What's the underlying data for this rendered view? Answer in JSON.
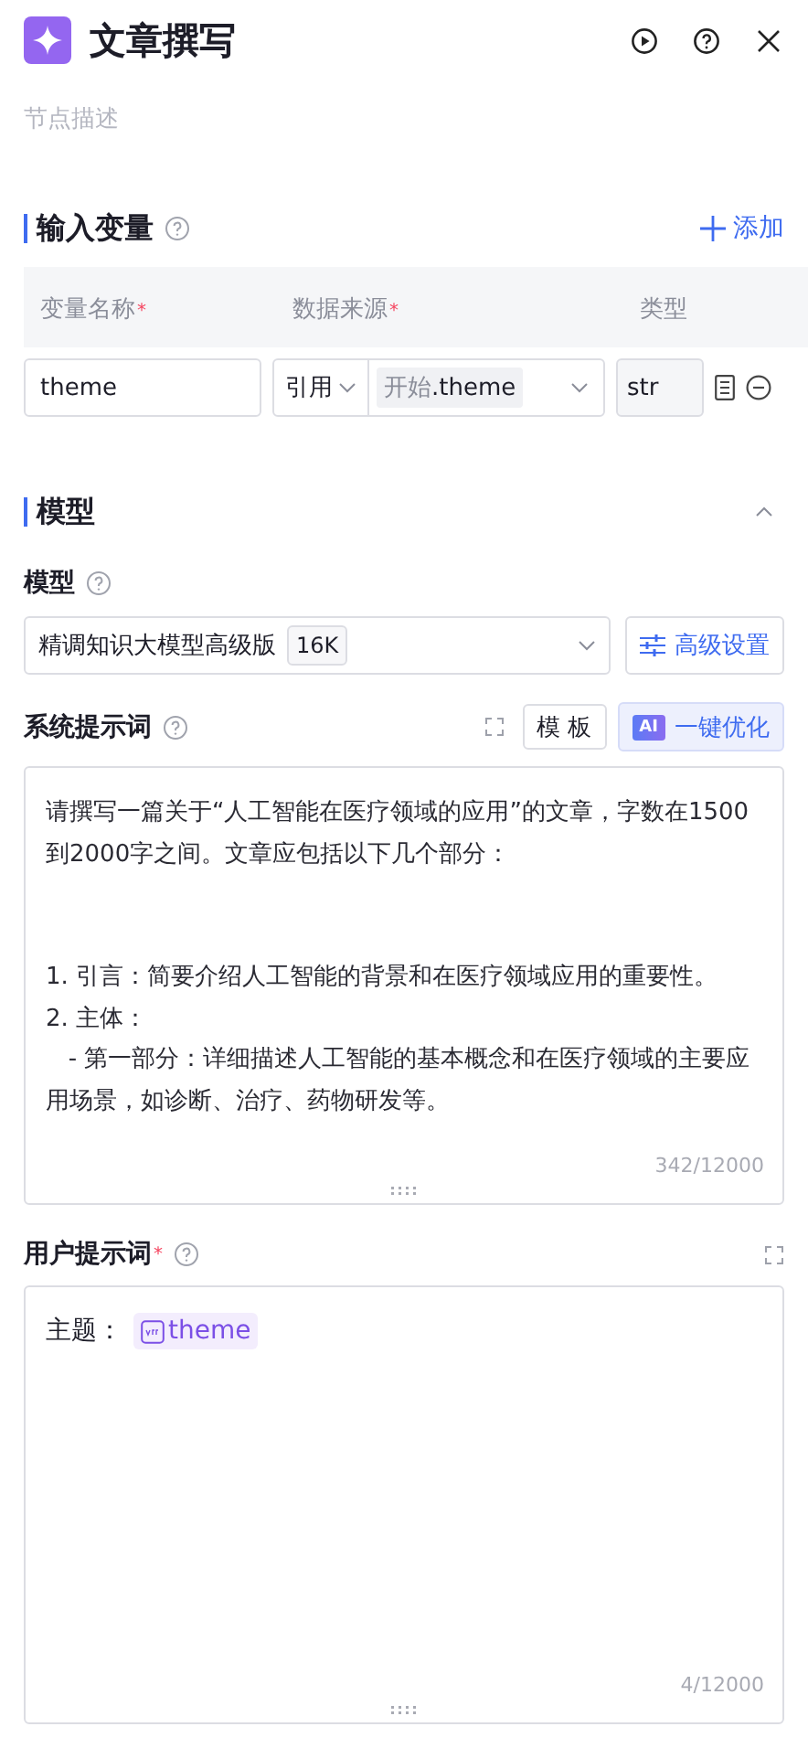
{
  "header": {
    "title": "文章撰写",
    "description": "节点描述"
  },
  "inputs": {
    "title": "输入变量",
    "required_mark": "*",
    "add_label": "添加",
    "columns": [
      {
        "label": "变量名称",
        "required": true
      },
      {
        "label": "数据来源",
        "required": true
      },
      {
        "label": "类型",
        "required": false
      }
    ],
    "rows": [
      {
        "name": "theme",
        "source_mode": "引用",
        "source_prefix": "开始",
        "source_value": ".theme",
        "type": "str"
      }
    ]
  },
  "model": {
    "title": "模型",
    "expanded": true,
    "field_label": "模型",
    "model_name": "精调知识大模型高级版",
    "context": "16K",
    "advanced_label": "高级设置"
  },
  "system_prompt": {
    "label": "系统提示词",
    "template_label": "模 板",
    "ai_badge": "AI",
    "optimize_label": "一键优化",
    "text": "请撰写一篇关于“人工智能在医疗领域的应用”的文章，字数在1500到2000字之间。文章应包括以下几个部分：\n\n\n1. 引言：简要介绍人工智能的背景和在医疗领域应用的重要性。\n2. 主体：\n   - 第一部分：详细描述人工智能的基本概念和在医疗领域的主要应用场景，如诊断、治疗、药物研发等。",
    "count": "342/12000"
  },
  "user_prompt": {
    "label": "用户提示词",
    "required": true,
    "required_mark": "*",
    "prefix": "主题：",
    "variable": "theme",
    "count": "4/12000"
  }
}
